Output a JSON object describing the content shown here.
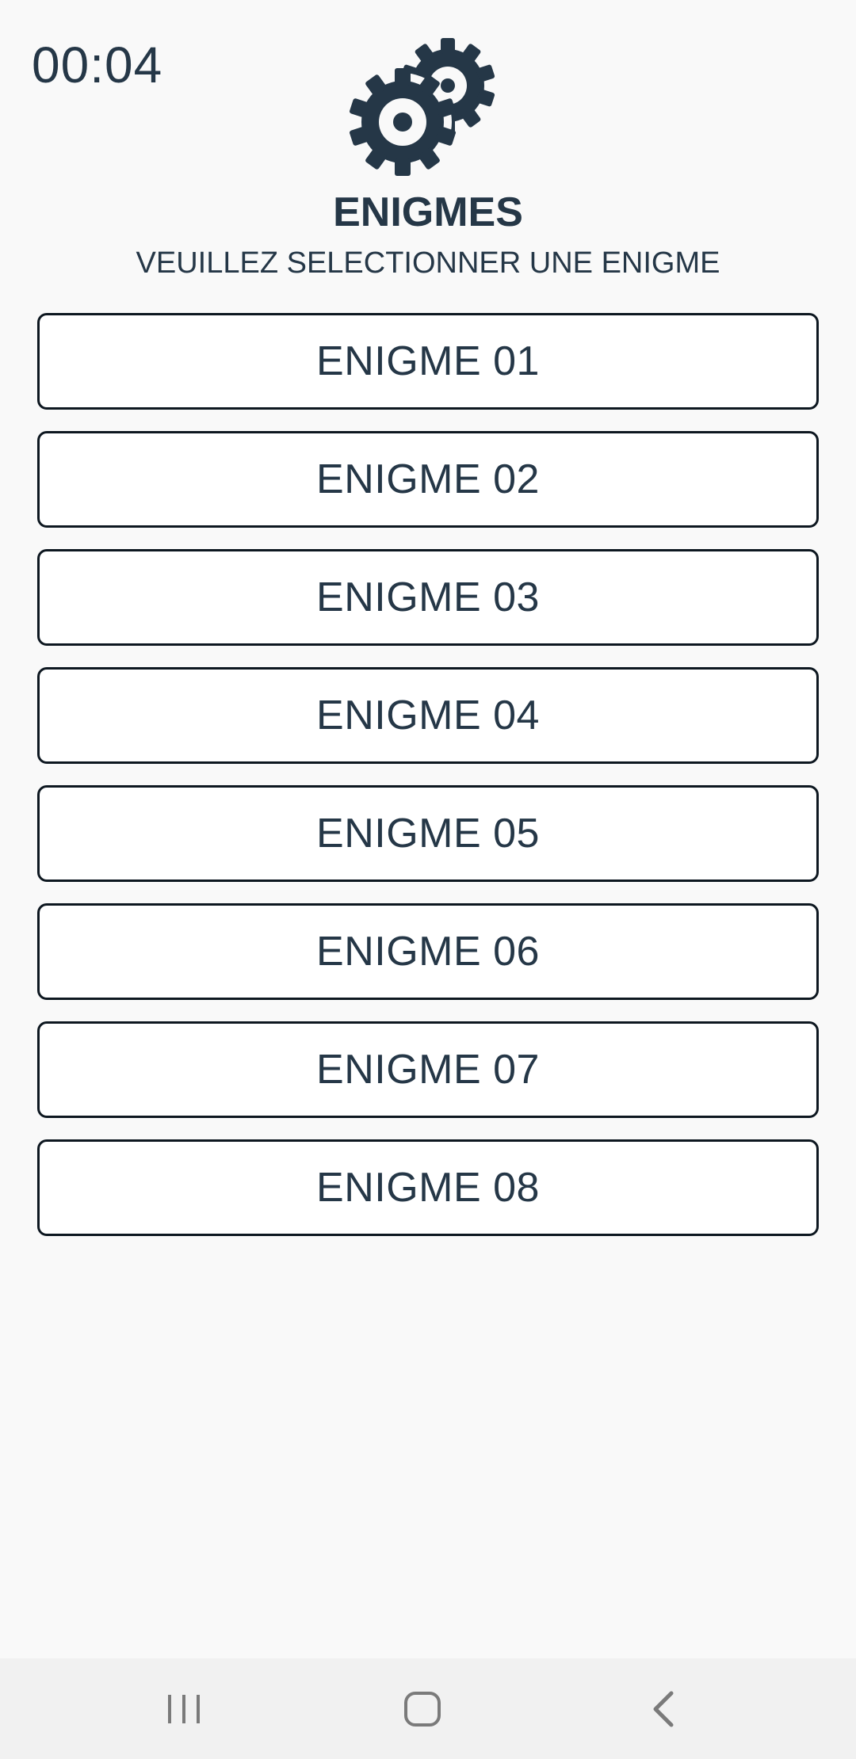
{
  "header": {
    "timer": "00:04",
    "logo_icon": "gears-icon",
    "title": "ENIGMES",
    "subtitle": "VEUILLEZ SELECTIONNER UNE ENIGME"
  },
  "enigmes": [
    {
      "label": "ENIGME 01"
    },
    {
      "label": "ENIGME 02"
    },
    {
      "label": "ENIGME 03"
    },
    {
      "label": "ENIGME 04"
    },
    {
      "label": "ENIGME 05"
    },
    {
      "label": "ENIGME 06"
    },
    {
      "label": "ENIGME 07"
    },
    {
      "label": "ENIGME 08"
    }
  ],
  "navbar": {
    "recents_icon": "recent-apps-icon",
    "home_icon": "home-icon",
    "back_icon": "back-icon"
  },
  "colors": {
    "background": "#f9f9f9",
    "text": "#253747",
    "button_border": "#0d1720",
    "button_fill": "#ffffff",
    "navbar": "#f1f1f1",
    "nav_icon": "#7a7a7a"
  }
}
